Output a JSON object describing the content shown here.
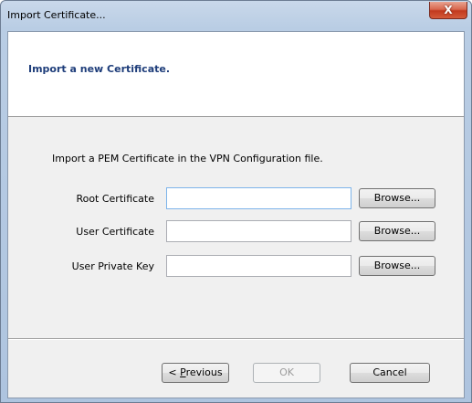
{
  "window": {
    "title": "Import Certificate...",
    "close_glyph": "X"
  },
  "header": {
    "title": "Import a new Certificate."
  },
  "body": {
    "instruction": "Import a PEM Certificate in the VPN Configuration file.",
    "rows": [
      {
        "label": "Root Certificate",
        "value": "",
        "browse": "Browse..."
      },
      {
        "label": "User Certificate",
        "value": "",
        "browse": "Browse..."
      },
      {
        "label": "User Private Key",
        "value": "",
        "browse": "Browse..."
      }
    ]
  },
  "footer": {
    "previous_prefix": "< ",
    "previous_mnemonic": "P",
    "previous_rest": "revious",
    "ok": "OK",
    "cancel": "Cancel"
  }
}
